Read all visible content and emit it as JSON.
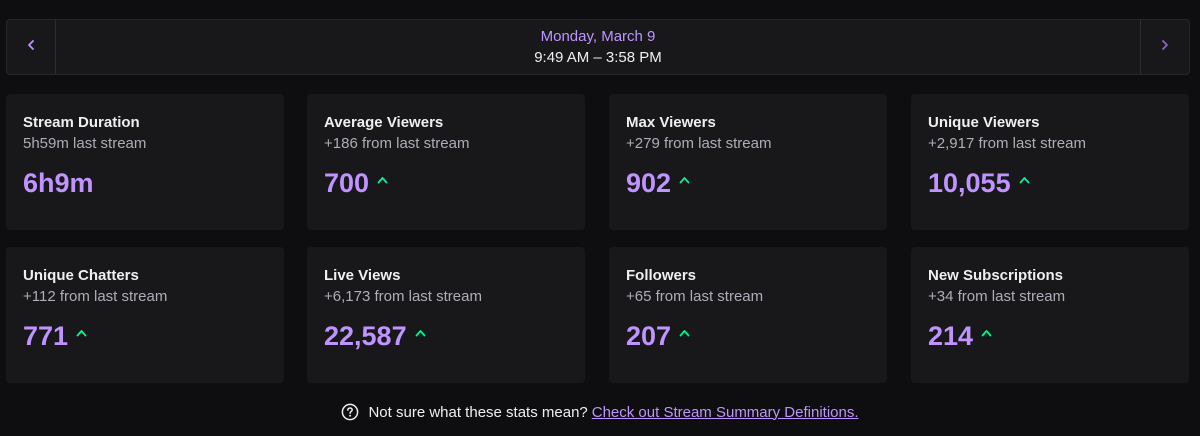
{
  "date_nav": {
    "date": "Monday, March 9",
    "time_range": "9:49 AM – 3:58 PM",
    "prev_icon": "chevron-left-icon",
    "next_icon": "chevron-right-icon"
  },
  "colors": {
    "accent": "#bf94ff",
    "increase": "#00f593",
    "card_bg": "#18181b",
    "page_bg": "#0e0e10"
  },
  "stats": [
    {
      "title": "Stream Duration",
      "subtitle": "5h59m last stream",
      "value": "6h9m",
      "trend": "none"
    },
    {
      "title": "Average Viewers",
      "subtitle": "+186 from last stream",
      "value": "700",
      "trend": "up"
    },
    {
      "title": "Max Viewers",
      "subtitle": "+279 from last stream",
      "value": "902",
      "trend": "up"
    },
    {
      "title": "Unique Viewers",
      "subtitle": "+2,917 from last stream",
      "value": "10,055",
      "trend": "up"
    },
    {
      "title": "Unique Chatters",
      "subtitle": "+112 from last stream",
      "value": "771",
      "trend": "up"
    },
    {
      "title": "Live Views",
      "subtitle": "+6,173 from last stream",
      "value": "22,587",
      "trend": "up"
    },
    {
      "title": "Followers",
      "subtitle": "+65 from last stream",
      "value": "207",
      "trend": "up"
    },
    {
      "title": "New Subscriptions",
      "subtitle": "+34 from last stream",
      "value": "214",
      "trend": "up"
    }
  ],
  "footer": {
    "question": "Not sure what these stats mean?",
    "link_text": "Check out Stream Summary Definitions.",
    "icon": "question-circle-icon"
  }
}
